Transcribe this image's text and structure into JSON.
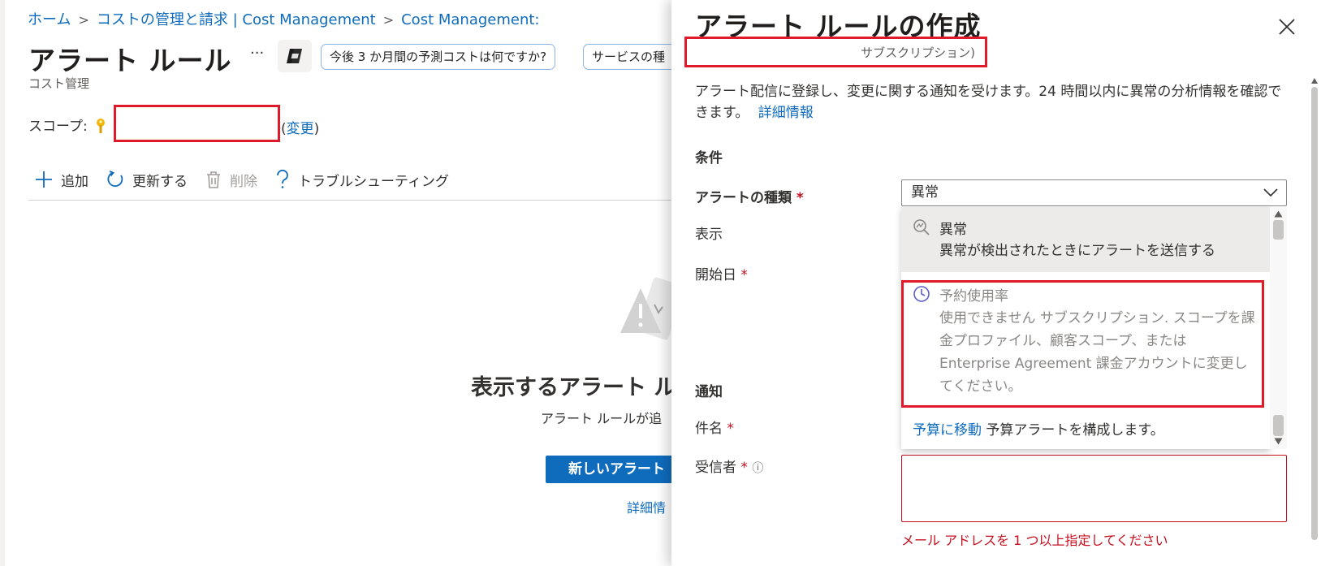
{
  "breadcrumb": {
    "items": [
      "ホーム",
      "コストの管理と請求 | Cost Management",
      "Cost Management:"
    ]
  },
  "page": {
    "title": "アラート ルール",
    "subtitle": "コスト管理",
    "more_label": "···",
    "chips": [
      "今後 3 か月間の予測コストは何ですか?",
      "サービスの種"
    ],
    "scope_label": "スコープ:",
    "change_link": "変更"
  },
  "toolbar": {
    "add": "追加",
    "refresh": "更新する",
    "delete": "削除",
    "troubleshoot": "トラブルシューティング"
  },
  "empty_state": {
    "title": "表示するアラート ル",
    "description": "アラート ルールが追",
    "new_button": "新しいアラート",
    "more_info": "詳細情"
  },
  "panel": {
    "title": "アラート ルールの作成",
    "subtitle": "サブスクリプション)",
    "description": "アラート配信に登録し、変更に関する通知を受けます。24 時間以内に異常の分析情報を確認できます。",
    "description_link": "詳細情報",
    "section_conditions": "条件",
    "alert_type_label": "アラートの種類",
    "alert_type_value": "異常",
    "display_label": "表示",
    "start_date_label": "開始日",
    "section_notification": "通知",
    "subject_label": "件名",
    "recipient_label": "受信者",
    "required_mark": "*",
    "info_icon": "ⓘ",
    "error_text": "メール アドレスを 1 つ以上指定してください"
  },
  "dropdown_menu": {
    "options": [
      {
        "title": "異常",
        "desc": "異常が検出されたときにアラートを送信する",
        "icon": "anomaly-search-icon"
      },
      {
        "title": "予約使用率",
        "desc": "使用できません サブスクリプション. スコープを課金プロファイル、顧客スコープ、または Enterprise Agreement 課金アカウントに変更してください。",
        "icon": "clock-icon"
      }
    ],
    "budget_link": "予算に移動",
    "budget_text": "予算アラートを構成します。"
  },
  "colors": {
    "accent": "#0f6cbd",
    "highlight": "#e01a2a",
    "error": "#c50f1f"
  }
}
